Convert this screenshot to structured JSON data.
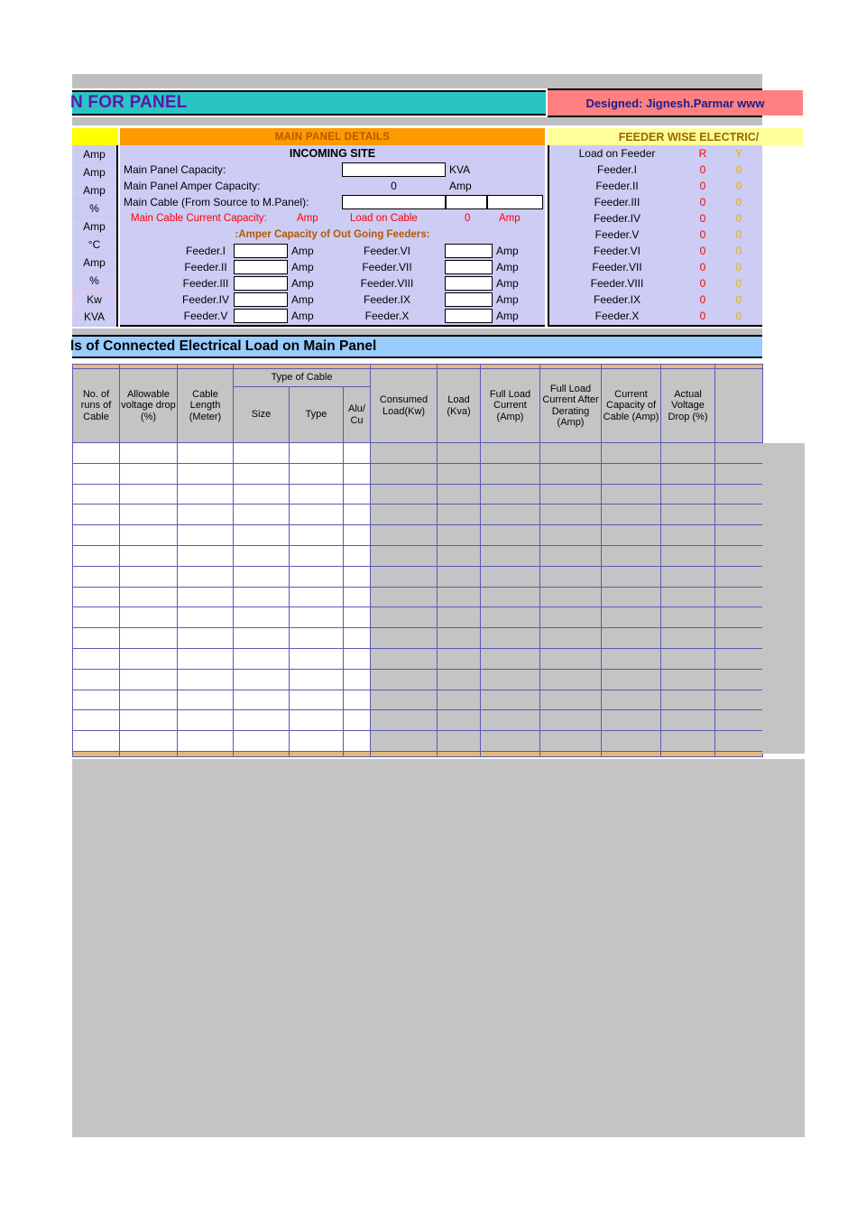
{
  "title_bar": {
    "text": "N FOR PANEL",
    "designed_by": "Designed: Jignesh.Parmar  www"
  },
  "banners": {
    "main_panel_details": "MAIN PANEL DETAILS",
    "feeder_wise": "FEEDER WISE ELECTRIC/",
    "connected_load": "ls of Connected Electrical Load on Main Panel"
  },
  "units_column": [
    "Amp",
    "Amp",
    "Amp",
    "%",
    "Amp",
    "°C",
    "Amp",
    "%",
    "Kw",
    "KVA"
  ],
  "main_panel": {
    "incoming_site": "INCOMING SITE",
    "capacity_label": "Main Panel Capacity:",
    "capacity_value": "",
    "capacity_unit": "KVA",
    "amper_capacity_label": "Main Panel Amper Capacity:",
    "amper_capacity_value": "0",
    "amper_capacity_unit": "Amp",
    "main_cable_label": "Main Cable (From Source to M.Panel):",
    "main_cable_size": "",
    "main_cable_type": "",
    "main_cable_alucu": "",
    "cable_current_capacity_label": "Main Cable Current Capacity:",
    "cable_current_capacity_unit": "Amp",
    "load_on_cable_label": "Load on Cable",
    "load_on_cable_value": "0",
    "load_on_cable_unit": "Amp",
    "outgoing_header": ":Amper Capacity of Out Going Feeders:",
    "feeders_left": [
      {
        "name": "Feeder.I",
        "value": "",
        "unit": "Amp"
      },
      {
        "name": "Feeder.II",
        "value": "",
        "unit": "Amp"
      },
      {
        "name": "Feeder.III",
        "value": "",
        "unit": "Amp"
      },
      {
        "name": "Feeder.IV",
        "value": "",
        "unit": "Amp"
      },
      {
        "name": "Feeder.V",
        "value": "",
        "unit": "Amp"
      }
    ],
    "feeders_right": [
      {
        "name": "Feeder.VI",
        "value": "",
        "unit": "Amp"
      },
      {
        "name": "Feeder.VII",
        "value": "",
        "unit": "Amp"
      },
      {
        "name": "Feeder.VIII",
        "value": "",
        "unit": "Amp"
      },
      {
        "name": "Feeder.IX",
        "value": "",
        "unit": "Amp"
      },
      {
        "name": "Feeder.X",
        "value": "",
        "unit": "Amp"
      }
    ]
  },
  "feeder_wise": {
    "header": {
      "name": "Load on Feeder",
      "r": "R",
      "y": "Y"
    },
    "rows": [
      {
        "name": "Feeder.I",
        "r": "0",
        "y": "0"
      },
      {
        "name": "Feeder.II",
        "r": "0",
        "y": "0"
      },
      {
        "name": "Feeder.III",
        "r": "0",
        "y": "0"
      },
      {
        "name": "Feeder.IV",
        "r": "0",
        "y": "0"
      },
      {
        "name": "Feeder.V",
        "r": "0",
        "y": "0"
      },
      {
        "name": "Feeder.VI",
        "r": "0",
        "y": "0"
      },
      {
        "name": "Feeder.VII",
        "r": "0",
        "y": "0"
      },
      {
        "name": "Feeder.VIII",
        "r": "0",
        "y": "0"
      },
      {
        "name": "Feeder.IX",
        "r": "0",
        "y": "0"
      },
      {
        "name": "Feeder.X",
        "r": "0",
        "y": "0"
      }
    ]
  },
  "load_table": {
    "group_header": "Type of Cable",
    "columns": [
      "No. of runs of Cable",
      "Allowable voltage drop (%)",
      "Cable Length (Meter)",
      "Size",
      "Type",
      "Alu/ Cu",
      "Consumed Load(Kw)",
      "Load (Kva)",
      "Full Load Current (Amp)",
      "Full Load Current After Derating (Amp)",
      "Current Capacity of Cable (Amp)",
      "Actual Voltage Drop (%)",
      ""
    ],
    "row_count": 15,
    "rows": [
      [
        "",
        "",
        "",
        "",
        "",
        "",
        "",
        "",
        "",
        "",
        "",
        "",
        ""
      ],
      [
        "",
        "",
        "",
        "",
        "",
        "",
        "",
        "",
        "",
        "",
        "",
        "",
        ""
      ],
      [
        "",
        "",
        "",
        "",
        "",
        "",
        "",
        "",
        "",
        "",
        "",
        "",
        ""
      ],
      [
        "",
        "",
        "",
        "",
        "",
        "",
        "",
        "",
        "",
        "",
        "",
        "",
        ""
      ],
      [
        "",
        "",
        "",
        "",
        "",
        "",
        "",
        "",
        "",
        "",
        "",
        "",
        ""
      ],
      [
        "",
        "",
        "",
        "",
        "",
        "",
        "",
        "",
        "",
        "",
        "",
        "",
        ""
      ],
      [
        "",
        "",
        "",
        "",
        "",
        "",
        "",
        "",
        "",
        "",
        "",
        "",
        ""
      ],
      [
        "",
        "",
        "",
        "",
        "",
        "",
        "",
        "",
        "",
        "",
        "",
        "",
        ""
      ],
      [
        "",
        "",
        "",
        "",
        "",
        "",
        "",
        "",
        "",
        "",
        "",
        "",
        ""
      ],
      [
        "",
        "",
        "",
        "",
        "",
        "",
        "",
        "",
        "",
        "",
        "",
        "",
        ""
      ],
      [
        "",
        "",
        "",
        "",
        "",
        "",
        "",
        "",
        "",
        "",
        "",
        "",
        ""
      ],
      [
        "",
        "",
        "",
        "",
        "",
        "",
        "",
        "",
        "",
        "",
        "",
        "",
        ""
      ],
      [
        "",
        "",
        "",
        "",
        "",
        "",
        "",
        "",
        "",
        "",
        "",
        "",
        ""
      ],
      [
        "",
        "",
        "",
        "",
        "",
        "",
        "",
        "",
        "",
        "",
        "",
        "",
        ""
      ],
      [
        "",
        "",
        "",
        "",
        "",
        "",
        "",
        "",
        "",
        "",
        "",
        "",
        ""
      ]
    ]
  },
  "colors": {
    "title_bg": "#2bc4c4",
    "title_text": "#5b19a8",
    "designed_bg": "#ff8080",
    "orange_banner": "#ff9900",
    "yellow_banner": "#ffff99",
    "blue_banner": "#99ccff",
    "lavender": "#ccccf5",
    "grid_line": "#5a5ab4",
    "calc_cell": "#c4c4c4",
    "band": "#e4b97a",
    "red": "#ff0000",
    "yellowphase": "#e8b000"
  }
}
